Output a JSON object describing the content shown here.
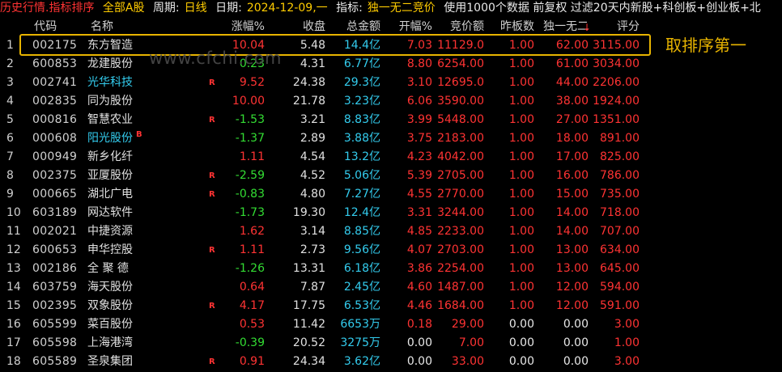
{
  "topbar": {
    "title": "历史行情.指标排序",
    "market": "全部A股",
    "period_label": "周期:",
    "period_value": "日线",
    "date_label": "日期:",
    "date_value": "2024-12-09,一",
    "indicator_label": "指标:",
    "indicator_value": "独一无二竞价",
    "options": "使用1000个数据 前复权 过滤20天内新股+科创板+创业板+北"
  },
  "columns": [
    "代码",
    "名称",
    "涨幅%",
    "收盘",
    "总金额",
    "开幅%",
    "竞价额",
    "昨板数",
    "独一无二",
    "评分"
  ],
  "annotation": "取排序第一",
  "watermark": "www.cfchi.com",
  "rows": [
    {
      "idx": "1",
      "code": "002175",
      "name": "东方智造",
      "flag": "",
      "chg": "10.04",
      "chg_color": "red",
      "close": "5.48",
      "amt": "14.4亿",
      "open": "7.03",
      "bid": "11129.0",
      "prev": "1.00",
      "uniq": "62.00",
      "score": "3115.00"
    },
    {
      "idx": "2",
      "code": "600853",
      "name": "龙建股份",
      "flag": "",
      "chg": "0.23",
      "chg_color": "green",
      "close": "4.31",
      "amt": "6.77亿",
      "open": "8.80",
      "bid": "6254.00",
      "prev": "1.00",
      "uniq": "61.00",
      "score": "3034.00"
    },
    {
      "idx": "3",
      "code": "002741",
      "name": "光华科技",
      "name_color": "cyan",
      "flag": "R",
      "chg": "9.52",
      "chg_color": "red",
      "close": "24.38",
      "amt": "29.3亿",
      "open": "3.10",
      "bid": "12695.0",
      "prev": "1.00",
      "uniq": "44.00",
      "score": "2206.00"
    },
    {
      "idx": "4",
      "code": "002835",
      "name": "同为股份",
      "flag": "",
      "chg": "10.00",
      "chg_color": "red",
      "close": "21.78",
      "amt": "3.23亿",
      "open": "6.06",
      "bid": "3590.00",
      "prev": "1.00",
      "uniq": "38.00",
      "score": "1924.00"
    },
    {
      "idx": "5",
      "code": "000816",
      "name": "智慧农业",
      "flag": "R",
      "chg": "-1.53",
      "chg_color": "green",
      "close": "3.21",
      "amt": "8.83亿",
      "open": "3.99",
      "bid": "5448.00",
      "prev": "1.00",
      "uniq": "27.00",
      "score": "1351.00"
    },
    {
      "idx": "6",
      "code": "000608",
      "name": "阳光股份",
      "name_color": "cyan",
      "flag": "B",
      "chg": "-1.37",
      "chg_color": "green",
      "close": "2.89",
      "amt": "3.88亿",
      "open": "3.75",
      "bid": "2183.00",
      "prev": "1.00",
      "uniq": "18.00",
      "score": "891.00"
    },
    {
      "idx": "7",
      "code": "000949",
      "name": "新乡化纤",
      "flag": "",
      "chg": "1.11",
      "chg_color": "red",
      "close": "4.54",
      "amt": "13.2亿",
      "open": "4.23",
      "bid": "4042.00",
      "prev": "1.00",
      "uniq": "17.00",
      "score": "825.00"
    },
    {
      "idx": "8",
      "code": "002375",
      "name": "亚厦股份",
      "flag": "R",
      "chg": "-2.59",
      "chg_color": "green",
      "close": "4.52",
      "amt": "5.06亿",
      "open": "5.39",
      "bid": "2705.00",
      "prev": "1.00",
      "uniq": "16.00",
      "score": "786.00"
    },
    {
      "idx": "9",
      "code": "000665",
      "name": "湖北广电",
      "flag": "R",
      "chg": "-0.83",
      "chg_color": "green",
      "close": "4.80",
      "amt": "7.27亿",
      "open": "4.55",
      "bid": "2770.00",
      "prev": "1.00",
      "uniq": "15.00",
      "score": "735.00"
    },
    {
      "idx": "10",
      "code": "603189",
      "name": "网达软件",
      "flag": "",
      "chg": "-1.73",
      "chg_color": "green",
      "close": "19.30",
      "amt": "12.4亿",
      "open": "3.31",
      "bid": "3244.00",
      "prev": "1.00",
      "uniq": "14.00",
      "score": "718.00"
    },
    {
      "idx": "11",
      "code": "002021",
      "name": "中捷资源",
      "flag": "",
      "chg": "1.62",
      "chg_color": "red",
      "close": "3.14",
      "amt": "8.85亿",
      "open": "4.85",
      "bid": "2233.00",
      "prev": "1.00",
      "uniq": "14.00",
      "score": "707.00"
    },
    {
      "idx": "12",
      "code": "600653",
      "name": "申华控股",
      "flag": "R",
      "chg": "1.11",
      "chg_color": "red",
      "close": "2.73",
      "amt": "9.56亿",
      "open": "4.07",
      "bid": "2703.00",
      "prev": "1.00",
      "uniq": "13.00",
      "score": "634.00"
    },
    {
      "idx": "13",
      "code": "002186",
      "name": "全 聚 德",
      "flag": "",
      "chg": "-1.26",
      "chg_color": "green",
      "close": "13.31",
      "amt": "6.18亿",
      "open": "3.86",
      "bid": "2254.00",
      "prev": "1.00",
      "uniq": "13.00",
      "score": "645.00"
    },
    {
      "idx": "14",
      "code": "603759",
      "name": "海天股份",
      "flag": "",
      "chg": "0.64",
      "chg_color": "red",
      "close": "7.87",
      "amt": "2.45亿",
      "open": "4.60",
      "bid": "1487.00",
      "prev": "1.00",
      "uniq": "12.00",
      "score": "594.00"
    },
    {
      "idx": "15",
      "code": "002395",
      "name": "双象股份",
      "flag": "R",
      "chg": "4.17",
      "chg_color": "red",
      "close": "17.75",
      "amt": "6.53亿",
      "open": "4.46",
      "bid": "1684.00",
      "prev": "1.00",
      "uniq": "12.00",
      "score": "591.00"
    },
    {
      "idx": "16",
      "code": "605599",
      "name": "菜百股份",
      "flag": "",
      "chg": "0.53",
      "chg_color": "red",
      "close": "11.42",
      "amt": "6653万",
      "open": "0.18",
      "bid": "29.00",
      "prev": "0.00",
      "uniq": "0.00",
      "score": "3.00"
    },
    {
      "idx": "17",
      "code": "605598",
      "name": "上海港湾",
      "flag": "",
      "chg": "-0.39",
      "chg_color": "green",
      "close": "20.52",
      "amt": "3275万",
      "open": "0.00",
      "bid": "7.00",
      "prev": "0.00",
      "uniq": "0.00",
      "score": "1.00"
    },
    {
      "idx": "18",
      "code": "605589",
      "name": "圣泉集团",
      "flag": "R",
      "chg": "0.91",
      "chg_color": "red",
      "close": "24.34",
      "amt": "3.62亿",
      "open": "0.00",
      "bid": "33.00",
      "prev": "0.00",
      "uniq": "0.00",
      "score": "3.00"
    }
  ]
}
